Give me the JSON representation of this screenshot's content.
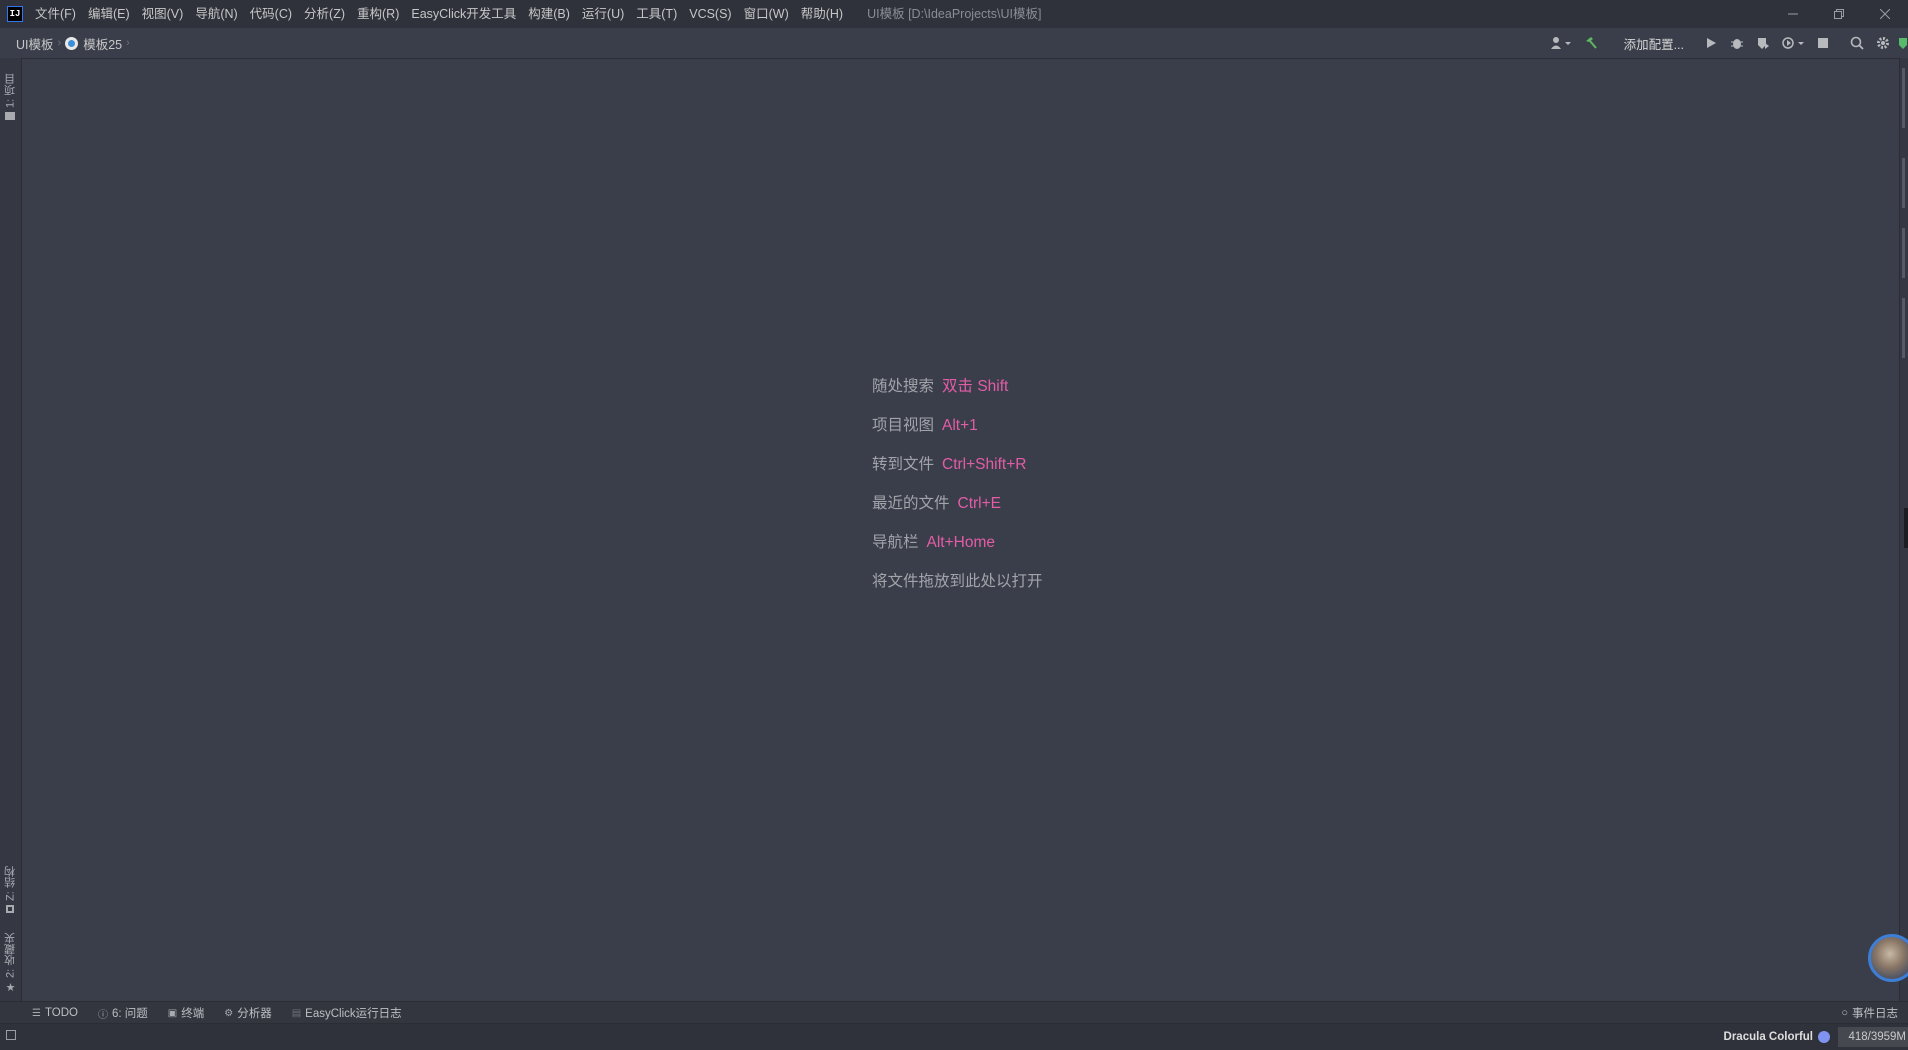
{
  "app": {
    "logo_text": "IJ",
    "window_title": "UI模板 [D:\\IdeaProjects\\UI模板]"
  },
  "menu": [
    {
      "label": "文件(F)",
      "name": "menu-file"
    },
    {
      "label": "编辑(E)",
      "name": "menu-edit"
    },
    {
      "label": "视图(V)",
      "name": "menu-view"
    },
    {
      "label": "导航(N)",
      "name": "menu-navigate"
    },
    {
      "label": "代码(C)",
      "name": "menu-code"
    },
    {
      "label": "分析(Z)",
      "name": "menu-analyze"
    },
    {
      "label": "重构(R)",
      "name": "menu-refactor"
    },
    {
      "label": "EasyClick开发工具",
      "name": "menu-easyclick"
    },
    {
      "label": "构建(B)",
      "name": "menu-build"
    },
    {
      "label": "运行(U)",
      "name": "menu-run"
    },
    {
      "label": "工具(T)",
      "name": "menu-tools"
    },
    {
      "label": "VCS(S)",
      "name": "menu-vcs"
    },
    {
      "label": "窗口(W)",
      "name": "menu-window"
    },
    {
      "label": "帮助(H)",
      "name": "menu-help"
    }
  ],
  "breadcrumb": {
    "project": "UI模板",
    "module": "模板25"
  },
  "toolbar": {
    "run_config": "添加配置..."
  },
  "left_tabs": {
    "project": "1: 项目",
    "structure": "Z: 结构",
    "favorites": "2: 收藏夹"
  },
  "hints": [
    {
      "label": "随处搜索",
      "key": "双击 Shift"
    },
    {
      "label": "项目视图",
      "key": "Alt+1"
    },
    {
      "label": "转到文件",
      "key": "Ctrl+Shift+R"
    },
    {
      "label": "最近的文件",
      "key": "Ctrl+E"
    },
    {
      "label": "导航栏",
      "key": "Alt+Home"
    },
    {
      "label": "将文件拖放到此处以打开",
      "key": ""
    }
  ],
  "tool_windows": {
    "todo": "TODO",
    "problems": "6: 问题",
    "terminal": "终端",
    "profiler": "分析器",
    "easyclick_log": "EasyClick运行日志",
    "event_log": "事件日志"
  },
  "status": {
    "theme": "Dracula Colorful",
    "memory": "418/3959M"
  },
  "colors": {
    "background": "#3a3e4a",
    "hint_key": "#e25da6",
    "build_icon": "#5fb85f",
    "theme_dot": "#8093f1"
  }
}
